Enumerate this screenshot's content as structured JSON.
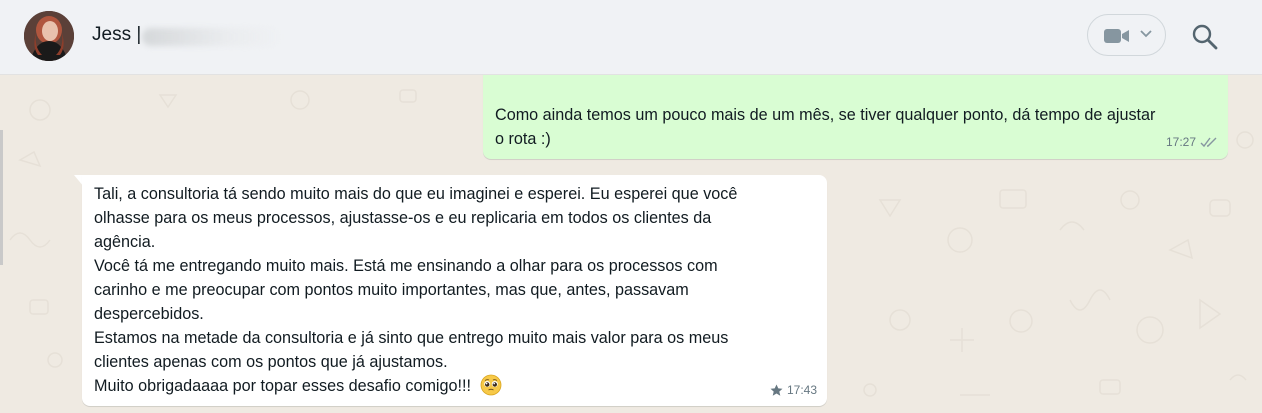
{
  "header": {
    "contact_name": "Jess |",
    "video_button_icon": "video-camera-icon",
    "dropdown_icon": "chevron-down-icon",
    "search_icon": "search-icon"
  },
  "messages": {
    "outgoing": {
      "lines": [
        "Como ainda temos um pouco mais de um mês, se tiver qualquer ponto, dá tempo de ajustar",
        "o rota :)"
      ],
      "time": "17:27",
      "status_icon": "double-check-icon"
    },
    "incoming": {
      "lines": [
        "Tali, a consultoria tá sendo muito mais do que eu imaginei e esperei. Eu esperei que você",
        "olhasse para os meus processos, ajustasse-os e eu replicaria em todos os clientes da",
        "agência.",
        "Você tá me entregando muito mais. Está me ensinando a olhar para os processos com",
        "carinho e me preocupar com pontos muito importantes, mas que, antes, passavam",
        "despercebidos.",
        "Estamos na metade da consultoria e já sinto que entrego muito mais valor para os meus",
        "clientes apenas com os pontos que já ajustamos.",
        "Muito obrigadaaaa por topar esses desafio comigo!!!"
      ],
      "emoji": "pleading-face-emoji",
      "time": "17:43",
      "starred_icon": "star-icon"
    }
  },
  "colors": {
    "outgoing_bubble": "#d9fdd3",
    "incoming_bubble": "#ffffff",
    "chat_background": "#efeae2",
    "header_background": "#f0f2f5"
  }
}
